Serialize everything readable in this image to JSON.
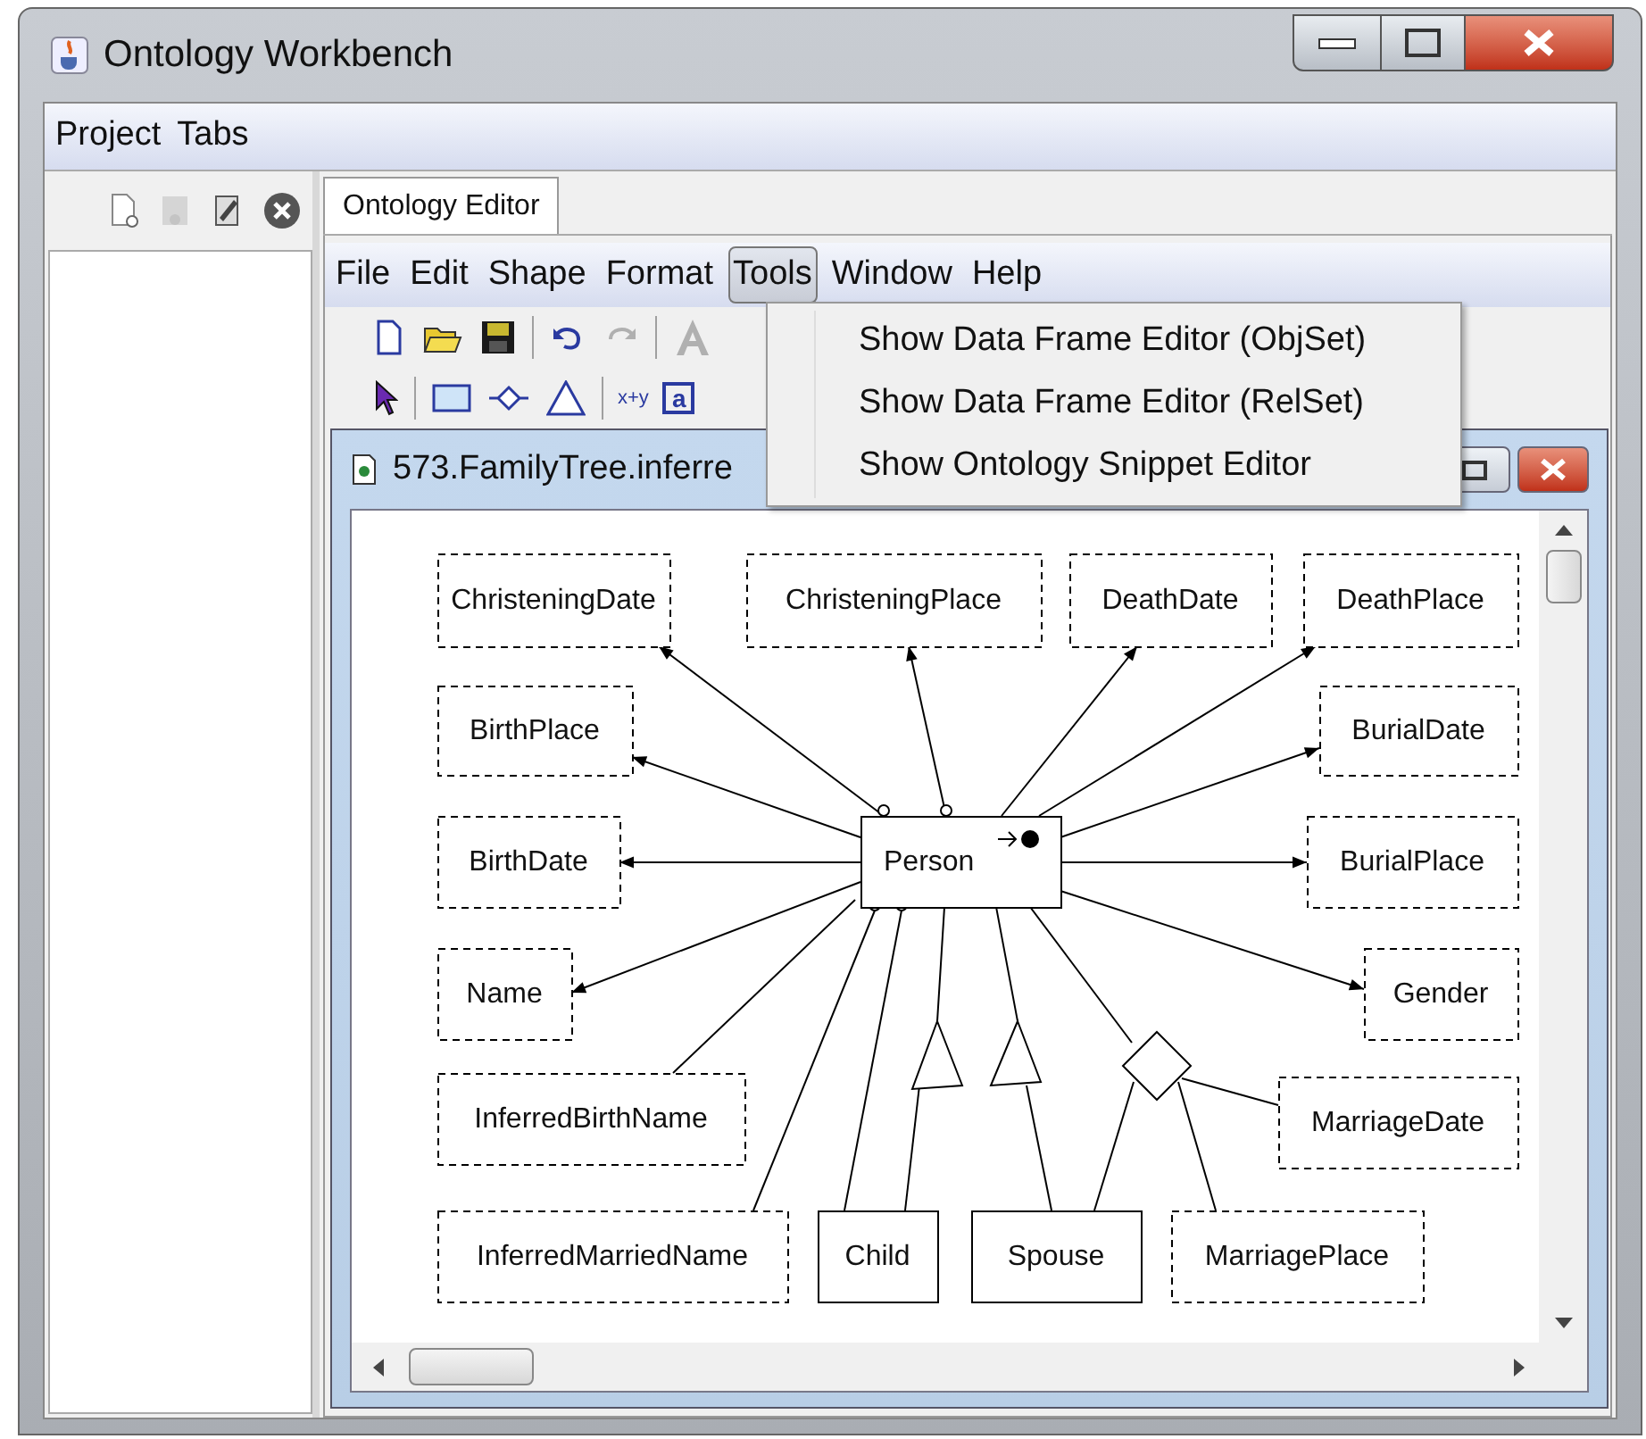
{
  "window": {
    "title": "Ontology Workbench"
  },
  "menubar": [
    {
      "label": "Project"
    },
    {
      "label": "Tabs"
    }
  ],
  "left_panel": {
    "toolbar": [
      {
        "kind": "new"
      },
      {
        "kind": "add",
        "disabled": true
      },
      {
        "kind": "edit"
      },
      {
        "kind": "close"
      }
    ]
  },
  "tabs": [
    {
      "label": "Ontology Editor",
      "selected": true
    }
  ],
  "editor_menubar": [
    {
      "label": "File",
      "selected": false
    },
    {
      "label": "Edit",
      "selected": false
    },
    {
      "label": "Shape",
      "selected": false
    },
    {
      "label": "Format",
      "selected": false
    },
    {
      "label": "Tools",
      "selected": true
    },
    {
      "label": "Window",
      "selected": false
    },
    {
      "label": "Help",
      "selected": false
    }
  ],
  "toolbar_rows": [
    [
      {
        "kind": "new"
      },
      {
        "kind": "open"
      },
      {
        "kind": "save"
      },
      {
        "kind": "sep"
      },
      {
        "kind": "undo"
      },
      {
        "kind": "redo",
        "disabled": true
      },
      {
        "kind": "sep"
      },
      {
        "kind": "font",
        "disabled": true
      }
    ],
    [
      {
        "kind": "pointer"
      },
      {
        "kind": "sep"
      },
      {
        "kind": "rect"
      },
      {
        "kind": "diamond"
      },
      {
        "kind": "triangle"
      },
      {
        "kind": "sep"
      },
      {
        "kind": "formula",
        "label": "x+y"
      },
      {
        "kind": "textbox",
        "label": "a"
      }
    ]
  ],
  "tools_menu": [
    {
      "label": "Show Data Frame Editor (ObjSet)"
    },
    {
      "label": "Show Data Frame Editor (RelSet)"
    },
    {
      "label": "Show Ontology Snippet Editor"
    }
  ],
  "internal_frame": {
    "title": "573.FamilyTree.inferre"
  },
  "diagram": {
    "nodes": [
      {
        "label": "ChristeningDate",
        "kind": "lexical"
      },
      {
        "label": "ChristeningPlace",
        "kind": "lexical"
      },
      {
        "label": "DeathDate",
        "kind": "lexical"
      },
      {
        "label": "DeathPlace",
        "kind": "lexical"
      },
      {
        "label": "BirthPlace",
        "kind": "lexical"
      },
      {
        "label": "BurialDate",
        "kind": "lexical"
      },
      {
        "label": "BirthDate",
        "kind": "lexical"
      },
      {
        "label": "Person",
        "kind": "nonlexical"
      },
      {
        "label": "BurialPlace",
        "kind": "lexical"
      },
      {
        "label": "Name",
        "kind": "lexical"
      },
      {
        "label": "Gender",
        "kind": "lexical"
      },
      {
        "label": "InferredBirthName",
        "kind": "lexical"
      },
      {
        "label": "MarriageDate",
        "kind": "lexical"
      },
      {
        "label": "InferredMarriedName",
        "kind": "lexical"
      },
      {
        "label": "Child",
        "kind": "nonlexical"
      },
      {
        "label": "Spouse",
        "kind": "nonlexical"
      },
      {
        "label": "MarriagePlace",
        "kind": "lexical"
      }
    ]
  }
}
